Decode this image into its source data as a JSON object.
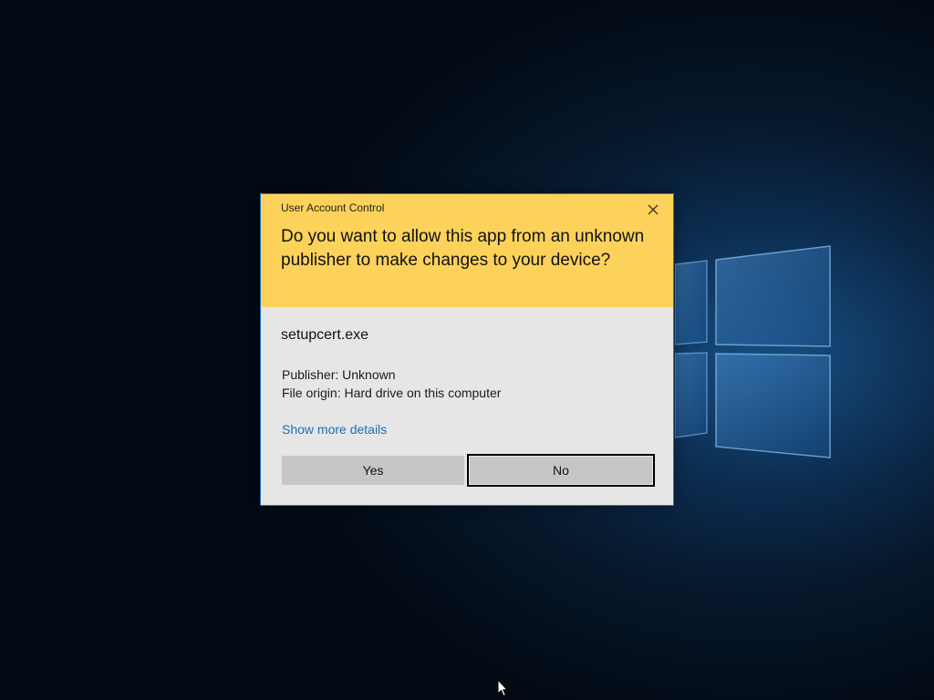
{
  "dialog": {
    "title": "User Account Control",
    "question": "Do you want to allow this app from an unknown publisher to make changes to your device?",
    "app_name": "setupcert.exe",
    "publisher": "Publisher: Unknown",
    "file_origin": "File origin: Hard drive on this computer",
    "details_link": "Show more details",
    "yes_label": "Yes",
    "no_label": "No",
    "close_icon": "close-icon"
  },
  "colors": {
    "header": "#fdd25a",
    "body": "#e6e6e6",
    "border": "#1e74c8",
    "link": "#1a6fb8",
    "button": "#c6c6c6"
  },
  "icons": [
    "windows-logo",
    "close-icon",
    "mouse-pointer-icon"
  ]
}
